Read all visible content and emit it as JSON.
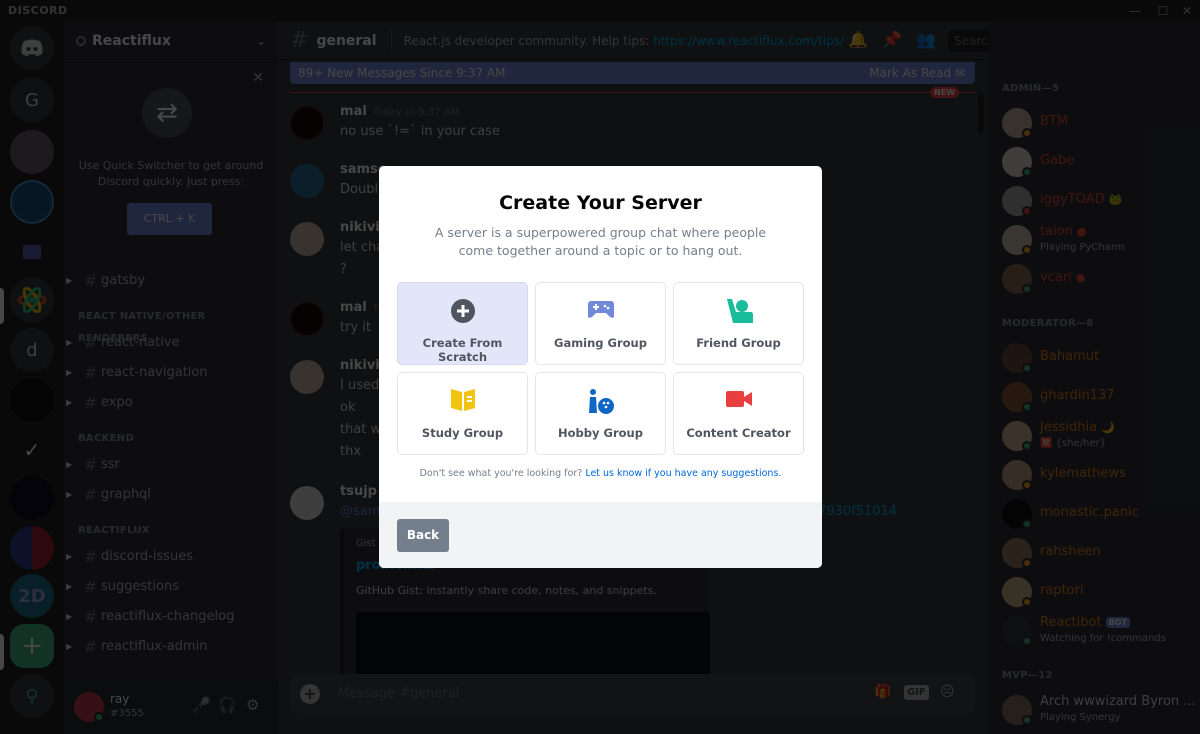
{
  "window": {
    "brand": "DISCORD",
    "controls": [
      "minimize",
      "maximize",
      "close"
    ]
  },
  "servers": [
    {
      "name": "home",
      "label": "",
      "icon": "discord-logo-icon",
      "color": "#36393f"
    },
    {
      "name": "G",
      "label": "G",
      "color": "#36393f"
    },
    {
      "name": "server-3",
      "label": "",
      "color": "#6b5c6e"
    },
    {
      "name": "server-4",
      "label": "",
      "color": "#1f4b7a"
    },
    {
      "name": "folder",
      "label": "",
      "icon": "folder-icon",
      "color": "#202225"
    },
    {
      "name": "reactiflux",
      "label": "",
      "icon": "react-icon",
      "color": "#36393f"
    },
    {
      "name": "d",
      "label": "d",
      "color": "#36393f"
    },
    {
      "name": "server-8",
      "label": "",
      "color": "#111111"
    },
    {
      "name": "server-9",
      "label": "",
      "icon": "chart-icon",
      "color": "#36393f"
    },
    {
      "name": "server-10",
      "label": "",
      "color": "#0e0e20"
    },
    {
      "name": "server-11",
      "label": "",
      "color": "#5a2a6a"
    },
    {
      "name": "2D",
      "label": "2D",
      "color": "#1f6f8b"
    },
    {
      "name": "add-server",
      "label": "+",
      "color": "#43b581"
    },
    {
      "name": "explore",
      "label": "",
      "icon": "search-icon",
      "color": "#36393f"
    }
  ],
  "guild": {
    "name": "Reactiflux",
    "quick_switcher": {
      "text": "Use Quick Switcher to get around Discord quickly. Just press:",
      "shortcut": "CTRL + K"
    },
    "categories": [
      {
        "name": "",
        "channels": [
          "gatsby"
        ]
      },
      {
        "name": "REACT NATIVE/OTHER RENDERERS",
        "channels": [
          "react-native",
          "react-navigation",
          "expo"
        ]
      },
      {
        "name": "BACKEND",
        "channels": [
          "ssr",
          "graphql"
        ]
      },
      {
        "name": "REACTIFLUX",
        "channels": [
          "discord-issues",
          "suggestions",
          "reactiflux-changelog",
          "reactiflux-admin"
        ]
      }
    ]
  },
  "user": {
    "name": "ray",
    "tag": "#3555",
    "status": "online"
  },
  "chat": {
    "channel": "general",
    "topic_prefix": "React.js developer community. Help tips: ",
    "topic_link": "https://www.reactiflux.com/tips/",
    "search_placeholder": "Search",
    "new_messages": "89+ New Messages Since 9:37 AM",
    "mark_as_read": "Mark As Read",
    "new_badge": "NEW",
    "messages": [
      {
        "author": "mal",
        "timestamp": "Today at 9:37 AM",
        "lines": [
          "no use `!=` in your case"
        ],
        "avatar_color": "#1a0a0a"
      },
      {
        "author": "samsc",
        "timestamp": "",
        "lines": [
          "Double"
        ],
        "avatar_color": "#2a6f97"
      },
      {
        "author": "nikivi",
        "timestamp": "",
        "lines": [
          "let cha",
          "?"
        ],
        "avatar_color": "#c9b8a8"
      },
      {
        "author": "mal",
        "timestamp": "T",
        "lines": [
          "try it"
        ],
        "avatar_color": "#1a0a0a"
      },
      {
        "author": "nikivi",
        "timestamp": "",
        "lines": [
          "I used",
          "ok",
          "that w",
          "thx"
        ],
        "avatar_color": "#c9b8a8"
      },
      {
        "author": "tsujp",
        "timestamp": "",
        "lines": [
          "@sam"
        ],
        "avatar_color": "#ddd"
      }
    ],
    "hash_fragment": "7930f51014",
    "embed": {
      "provider": "Gist",
      "title": "problem.ts",
      "description": "GitHub Gist: instantly share code, notes, and snippets."
    },
    "composer_placeholder": "Message #general",
    "composer_gif": "GIF"
  },
  "members": {
    "groups": [
      {
        "title": "ADMIN—5",
        "members": [
          {
            "name": "BTM",
            "color": "#e74c3c",
            "status": "#faa61a",
            "avatar": "#c4b5a0"
          },
          {
            "name": "Gabe",
            "color": "#e74c3c",
            "status": "#43b581",
            "avatar": "#e0d6cc"
          },
          {
            "name": "iggyTOAD",
            "color": "#e74c3c",
            "status": "#f04747",
            "avatar": "#aaa",
            "emoji": "🐸"
          },
          {
            "name": "taion",
            "color": "#e74c3c",
            "status": "#faa61a",
            "avatar": "#cfc5b8",
            "activity": "Playing PyCharm",
            "emoji": "●"
          },
          {
            "name": "vcarl",
            "color": "#e74c3c",
            "status": "#43b581",
            "avatar": "#8a6d55",
            "emoji": "●"
          }
        ]
      },
      {
        "title": "MODERATOR—8",
        "members": [
          {
            "name": "Bahamut",
            "color": "#e67e22",
            "status": "#43b581",
            "avatar": "#6b4a3a"
          },
          {
            "name": "ghardin137",
            "color": "#e67e22",
            "status": "#43b581",
            "avatar": "#8b5a3c"
          },
          {
            "name": "Jessidhia",
            "color": "#e67e22",
            "status": "#43b581",
            "avatar": "#d4b896",
            "activity": "🈲 {she/her}",
            "emoji": "🌙"
          },
          {
            "name": "kylemathews",
            "color": "#e67e22",
            "status": "#faa61a",
            "avatar": "#c8a080"
          },
          {
            "name": "monastic.panic",
            "color": "#e67e22",
            "status": "#43b581",
            "avatar": "#111"
          },
          {
            "name": "rahsheen",
            "color": "#e67e22",
            "status": "#faa61a",
            "avatar": "#9a7a60"
          },
          {
            "name": "raptori",
            "color": "#e67e22",
            "status": "#faa61a",
            "avatar": "#c8b08a"
          },
          {
            "name": "Reactibot",
            "color": "#e67e22",
            "status": "#43b581",
            "avatar": "#36393f",
            "activity": "Watching for !commands",
            "badge": "BOT"
          }
        ]
      },
      {
        "title": "MVP—12",
        "members": [
          {
            "name": "Arch wwwizard Byron ...",
            "color": "#dcddde",
            "status": "#43b581",
            "avatar": "#8a7060",
            "activity": "Playing Synergy"
          }
        ]
      }
    ]
  },
  "modal": {
    "title": "Create Your Server",
    "description": "A server is a superpowered group chat where people come together around a topic or to hang out.",
    "options": [
      {
        "label": "Create From Scratch",
        "icon": "plus-circle-icon",
        "selected": true
      },
      {
        "label": "Gaming Group",
        "icon": "gamepad-icon",
        "selected": false
      },
      {
        "label": "Friend Group",
        "icon": "friend-wave-icon",
        "selected": false
      },
      {
        "label": "Study Group",
        "icon": "book-icon",
        "selected": false
      },
      {
        "label": "Hobby Group",
        "icon": "bowling-icon",
        "selected": false
      },
      {
        "label": "Content Creator",
        "icon": "video-camera-icon",
        "selected": false
      }
    ],
    "hint_text": "Don't see what you're looking for? ",
    "hint_link": "Let us know if you have any suggestions.",
    "back_label": "Back",
    "icon_colors": {
      "plus": "#4f5660",
      "gaming": "#7289da",
      "friend": "#1abc9c",
      "study": "#f1c40f",
      "hobby": "#0f66c4",
      "content": "#e84040"
    }
  }
}
